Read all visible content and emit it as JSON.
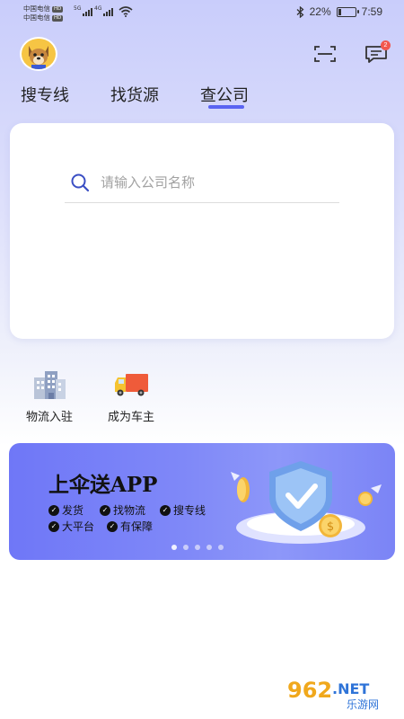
{
  "status_bar": {
    "carrier1": "中国电信",
    "carrier2": "中国电信",
    "hd": "HD",
    "net1": "5G",
    "net2": "4G",
    "battery_percent": "22%",
    "battery_level": 0.22,
    "time": "7:59"
  },
  "header": {
    "avatar_icon": "dog-mascot-avatar",
    "scan_icon": "scan-icon",
    "message_icon": "message-icon",
    "message_badge": "2"
  },
  "tabs": [
    {
      "label": "搜专线",
      "active": false
    },
    {
      "label": "找货源",
      "active": false
    },
    {
      "label": "查公司",
      "active": true
    }
  ],
  "search": {
    "placeholder": "请输入公司名称",
    "value": ""
  },
  "shortcuts": [
    {
      "label": "物流入驻",
      "icon": "building-icon"
    },
    {
      "label": "成为车主",
      "icon": "truck-icon"
    }
  ],
  "banner": {
    "title": "上伞送APP",
    "features": [
      "发货",
      "找物流",
      "搜专线",
      "大平台",
      "有保障"
    ],
    "page_count": 5,
    "active_page": 1
  },
  "watermark": {
    "brand": "962.NET",
    "sub": "乐游网"
  },
  "colors": {
    "accent": "#5a64f2",
    "banner": "#7f88f8",
    "badge": "#f2574e"
  }
}
